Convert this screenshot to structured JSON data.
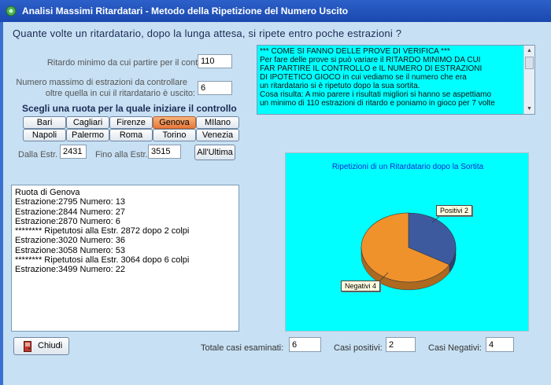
{
  "window": {
    "title": "Analisi Massimi Ritardatari - Metodo della Ripetizione del Numero Uscito"
  },
  "question": "Quante volte un  ritardatario, dopo la lunga attesa, si ripete entro poche estrazioni ?",
  "form": {
    "ritardo_label": "Ritardo minimo da cui partire per il controllo",
    "ritardo_value": "110",
    "numero_label_1": "Numero massimo di estrazioni da controllare",
    "numero_label_2": "oltre quella in cui il ritardatario è uscito:",
    "numero_value": "6",
    "scegli_label": "Scegli una ruota per la quale iniziare il controllo",
    "dalla_label": "Dalla Estr.",
    "dalla_value": "2431",
    "fino_label": "Fino alla Estr.",
    "fino_value": "3515",
    "all_ultima_label": "All'Ultima"
  },
  "ruote": [
    {
      "label": "Bari",
      "selected": false
    },
    {
      "label": "Cagliari",
      "selected": false
    },
    {
      "label": "Firenze",
      "selected": false
    },
    {
      "label": "Genova",
      "selected": true
    },
    {
      "label": "MIlano",
      "selected": false
    },
    {
      "label": "Napoli",
      "selected": false
    },
    {
      "label": "Palermo",
      "selected": false
    },
    {
      "label": "Roma",
      "selected": false
    },
    {
      "label": "Torino",
      "selected": false
    },
    {
      "label": "Venezia",
      "selected": false
    }
  ],
  "notes": [
    "*** COME SI FANNO DELLE PROVE DI VERIFICA ***",
    "Per fare delle prove si può variare il RITARDO MINIMO DA CUI",
    "FAR PARTIRE IL CONTROLLO e IL NUMERO DI ESTRAZIONI",
    "DI IPOTETICO GIOCO in cui vediamo se il numero che era",
    "un ritardatario si è ripetuto dopo la sua sortita.",
    "Cosa risulta:  A mio parere i risultati migliori si hanno se aspettiamo",
    "un minimo di 110 estrazioni di ritardo e poniamo in gioco per 7 volte"
  ],
  "output_lines": [
    "Ruota di Genova",
    "Estrazione:2795 Numero: 13",
    "Estrazione:2844 Numero: 27",
    "Estrazione:2870 Numero: 6",
    " ******** Ripetutosi alla Estr. 2872 dopo 2 colpi",
    "Estrazione:3020 Numero: 36",
    "Estrazione:3058 Numero: 53",
    " ******** Ripetutosi alla Estr. 3064 dopo 6 colpi",
    "Estrazione:3499 Numero: 22"
  ],
  "chart_data": {
    "type": "pie",
    "title": "Ripetizioni di un Ritardatario dopo la Sortita",
    "slices": [
      {
        "label": "Positivi 2",
        "value": 2,
        "color": "#3d5a9e"
      },
      {
        "label": "Negativi 4",
        "value": 4,
        "color": "#f0922c"
      }
    ],
    "colors": {
      "background": "#00ffff",
      "title": "#1a2ad0"
    }
  },
  "footer": {
    "chiudi_label": "Chiudi",
    "totale_label": "Totale casi  esaminati:",
    "totale_value": "6",
    "positivi_label": "Casi positivi:",
    "positivi_value": "2",
    "negativi_label": "Casi Negativi:",
    "negativi_value": "4"
  }
}
